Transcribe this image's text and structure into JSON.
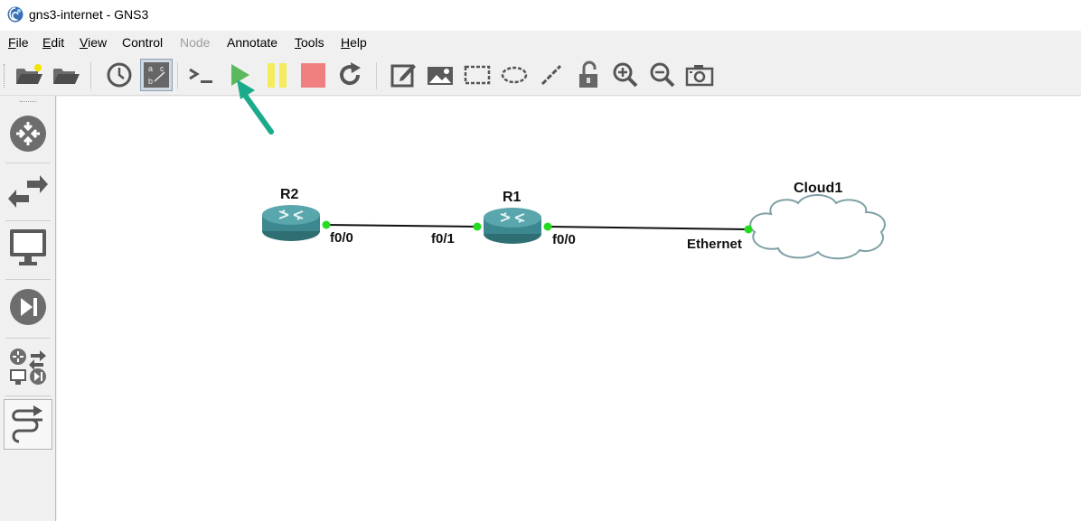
{
  "window": {
    "title": "gns3-internet - GNS3",
    "app_icon": "gns3-logo-icon"
  },
  "menu": {
    "items": [
      {
        "label": "File",
        "underline": "F",
        "rest": "ile",
        "enabled": true
      },
      {
        "label": "Edit",
        "underline": "E",
        "rest": "dit",
        "enabled": true
      },
      {
        "label": "View",
        "underline": "V",
        "rest": "iew",
        "enabled": true
      },
      {
        "label": "Control",
        "underline": "",
        "rest": "Control",
        "enabled": true
      },
      {
        "label": "Node",
        "underline": "",
        "rest": "Node",
        "enabled": false
      },
      {
        "label": "Annotate",
        "underline": "",
        "rest": "Annotate",
        "enabled": true
      },
      {
        "label": "Tools",
        "underline": "T",
        "rest": "ools",
        "enabled": true
      },
      {
        "label": "Help",
        "underline": "H",
        "rest": "elp",
        "enabled": true
      }
    ]
  },
  "toolbar": {
    "buttons": [
      {
        "icon": "new-project-folder-icon"
      },
      {
        "icon": "open-project-folder-icon"
      },
      {
        "icon": "snapshot-clock-icon"
      },
      {
        "icon": "show-interface-labels-icon",
        "active": true
      },
      {
        "icon": "console-all-icon"
      },
      {
        "icon": "start-all-play-icon",
        "color": "#4caf50"
      },
      {
        "icon": "suspend-all-pause-icon",
        "color": "#f4e84a"
      },
      {
        "icon": "stop-all-icon",
        "color": "#f08080"
      },
      {
        "icon": "reload-all-icon"
      },
      {
        "icon": "add-note-icon"
      },
      {
        "icon": "insert-picture-icon"
      },
      {
        "icon": "draw-rectangle-icon"
      },
      {
        "icon": "draw-ellipse-icon"
      },
      {
        "icon": "draw-line-icon"
      },
      {
        "icon": "lock-unlock-icon"
      },
      {
        "icon": "zoom-in-icon"
      },
      {
        "icon": "zoom-out-icon"
      },
      {
        "icon": "screenshot-camera-icon"
      }
    ]
  },
  "device_panel": {
    "buttons": [
      {
        "icon": "routers-icon"
      },
      {
        "icon": "switches-icon"
      },
      {
        "icon": "end-devices-icon"
      },
      {
        "icon": "security-devices-icon"
      },
      {
        "icon": "all-devices-icon"
      },
      {
        "icon": "add-link-icon"
      }
    ]
  },
  "topology": {
    "nodes": [
      {
        "id": "R2",
        "label": "R2",
        "type": "router"
      },
      {
        "id": "R1",
        "label": "R1",
        "type": "router"
      },
      {
        "id": "Cloud1",
        "label": "Cloud1",
        "type": "cloud"
      }
    ],
    "links": [
      {
        "from": "R2",
        "from_port": "f0/0",
        "to": "R1",
        "to_port": "f0/1",
        "status": "up"
      },
      {
        "from": "R1",
        "from_port": "f0/0",
        "to": "Cloud1",
        "to_port": "Ethernet",
        "status": "up"
      }
    ],
    "link_status_color": "#22dd22"
  },
  "annotation": {
    "pointer_arrow_color": "#1aab8a",
    "points_to": "start-all-play-icon"
  }
}
